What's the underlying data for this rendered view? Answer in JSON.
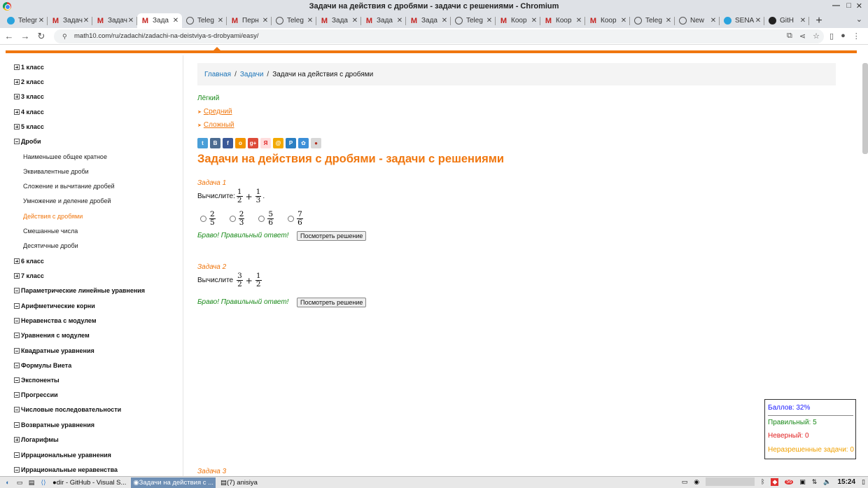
{
  "window": {
    "title": "Задачи на действия с дробями - задачи с решениями - Chromium"
  },
  "tabs": [
    {
      "label": "Telegr",
      "icon": "telegram-icon",
      "active": false
    },
    {
      "label": "Задач",
      "icon": "gmail-icon",
      "active": false
    },
    {
      "label": "Задач",
      "icon": "gmail-icon",
      "active": false
    },
    {
      "label": "Зада",
      "icon": "gmail-icon",
      "active": true
    },
    {
      "label": "Teleg",
      "icon": "globe-icon",
      "active": false
    },
    {
      "label": "Перн",
      "icon": "gmail-icon",
      "active": false
    },
    {
      "label": "Teleg",
      "icon": "globe-icon",
      "active": false
    },
    {
      "label": "Зада",
      "icon": "gmail-icon",
      "active": false
    },
    {
      "label": "Зада",
      "icon": "gmail-icon",
      "active": false
    },
    {
      "label": "Зада",
      "icon": "gmail-icon",
      "active": false
    },
    {
      "label": "Teleg",
      "icon": "globe-icon",
      "active": false
    },
    {
      "label": "Коор",
      "icon": "gmail-icon",
      "active": false
    },
    {
      "label": "Коор",
      "icon": "gmail-icon",
      "active": false
    },
    {
      "label": "Коор",
      "icon": "gmail-icon",
      "active": false
    },
    {
      "label": "Teleg",
      "icon": "globe-icon",
      "active": false
    },
    {
      "label": "New",
      "icon": "globe-icon",
      "active": false
    },
    {
      "label": "SENA",
      "icon": "telegram-icon",
      "active": false
    },
    {
      "label": "GitH",
      "icon": "github-icon",
      "active": false
    }
  ],
  "toolbar": {
    "url": "math10.com/ru/zadachi/zadachi-na-deistviya-s-drobyami/easy/",
    "new_tab_glyph": "+"
  },
  "sidebar": {
    "items": [
      {
        "label": "1 класс",
        "expanded": false
      },
      {
        "label": "2 класс",
        "expanded": false
      },
      {
        "label": "3 класс",
        "expanded": false
      },
      {
        "label": "4 класс",
        "expanded": false
      },
      {
        "label": "5 класс",
        "expanded": false
      },
      {
        "label": "Дроби",
        "expanded": true
      },
      {
        "label": "6 класс",
        "expanded": false
      },
      {
        "label": "7 класс",
        "expanded": false
      },
      {
        "label": "Параметрические линейные уравнения",
        "expanded": true
      },
      {
        "label": "Арифметические корни",
        "expanded": true
      },
      {
        "label": "Неравенства с модулем",
        "expanded": true
      },
      {
        "label": "Уравнения с модулем",
        "expanded": true
      },
      {
        "label": "Квадратные уравнения",
        "expanded": true
      },
      {
        "label": "Формулы Виета",
        "expanded": true
      },
      {
        "label": "Экспоненты",
        "expanded": true
      },
      {
        "label": "Прогрессии",
        "expanded": true
      },
      {
        "label": "Числовые последовательности",
        "expanded": true
      },
      {
        "label": "Возвратные уравнения",
        "expanded": true
      },
      {
        "label": "Логарифмы",
        "expanded": false
      },
      {
        "label": "Иррациональные уравнения",
        "expanded": true
      },
      {
        "label": "Иррациональные неравенства",
        "expanded": true
      }
    ],
    "subitems": [
      {
        "label": "Наименьшее общее кратное",
        "active": false
      },
      {
        "label": "Эквивалентные дроби",
        "active": false
      },
      {
        "label": "Сложение и вычитание дробей",
        "active": false
      },
      {
        "label": "Умножение и деление дробей",
        "active": false
      },
      {
        "label": "Действия с дробями",
        "active": true
      },
      {
        "label": "Смешанные числа",
        "active": false
      },
      {
        "label": "Десятичные дроби",
        "active": false
      }
    ]
  },
  "breadcrumb": {
    "home": "Главная",
    "section": "Задачи",
    "current": "Задачи на действия с дробями",
    "sep": "/"
  },
  "levels": {
    "current": "Лёгкий",
    "medium": "Средний",
    "hard": "Сложный"
  },
  "share_icons": [
    {
      "name": "twitter-icon",
      "glyph": "t",
      "color": "#4a9fd8"
    },
    {
      "name": "vk-icon",
      "glyph": "В",
      "color": "#4c6c91"
    },
    {
      "name": "facebook-icon",
      "glyph": "f",
      "color": "#3b5998"
    },
    {
      "name": "odnoklassniki-icon",
      "glyph": "о",
      "color": "#f29400"
    },
    {
      "name": "google-plus-icon",
      "glyph": "g+",
      "color": "#dd4b39"
    },
    {
      "name": "yandex-icon",
      "glyph": "Я",
      "color": "#ffdddd"
    },
    {
      "name": "mail-ru-icon",
      "glyph": "@",
      "color": "#f2a900"
    },
    {
      "name": "liveinternet-icon",
      "glyph": "Р",
      "color": "#2b7fc2"
    },
    {
      "name": "settings-icon",
      "glyph": "✿",
      "color": "#3b8fd8"
    },
    {
      "name": "ladybug-icon",
      "glyph": "●",
      "color": "#d8d8d8"
    }
  ],
  "heading": "Задачи на действия с дробями - задачи с решениями",
  "tasks": [
    {
      "title": "Задача 1",
      "prompt": "Вычислите:",
      "expr": {
        "a_num": "1",
        "a_den": "2",
        "op": "+",
        "b_num": "1",
        "b_den": "3",
        "tail": "."
      },
      "options": [
        {
          "num": "2",
          "den": "5"
        },
        {
          "num": "2",
          "den": "3"
        },
        {
          "num": "5",
          "den": "6"
        },
        {
          "num": "7",
          "den": "6"
        }
      ],
      "feedback": "Браво! Правильный ответ!",
      "button": "Посмотреть решение"
    },
    {
      "title": "Задача 2",
      "prompt": "Вычислите",
      "expr": {
        "a_num": "3",
        "a_den": "2",
        "op": "+",
        "b_num": "1",
        "b_den": "2",
        "tail": ""
      },
      "feedback": "Браво! Правильный ответ!",
      "button": "Посмотреть решение"
    },
    {
      "title": "Задача 3"
    }
  ],
  "score": {
    "points": "Баллов: 32%",
    "correct": "Правильный: 5",
    "wrong": "Неверный: 0",
    "unsolved": "Неразрешенные задачи: 0",
    "colors": {
      "points": "#1a1aff",
      "correct": "#1a8a1a",
      "wrong": "#e02020",
      "unsolved": "#f0a000"
    }
  },
  "taskbar": {
    "tasks": [
      {
        "label": "dir - GitHub - Visual S...",
        "active": false
      },
      {
        "label": "Задачи на действия с ...",
        "active": true
      },
      {
        "label": "(7) anisiya",
        "active": false
      }
    ],
    "badge": "56",
    "clock": "15:24"
  },
  "colors": {
    "accent": "#f0770f",
    "link": "#1a73b8",
    "correct": "#1a8a1a"
  }
}
